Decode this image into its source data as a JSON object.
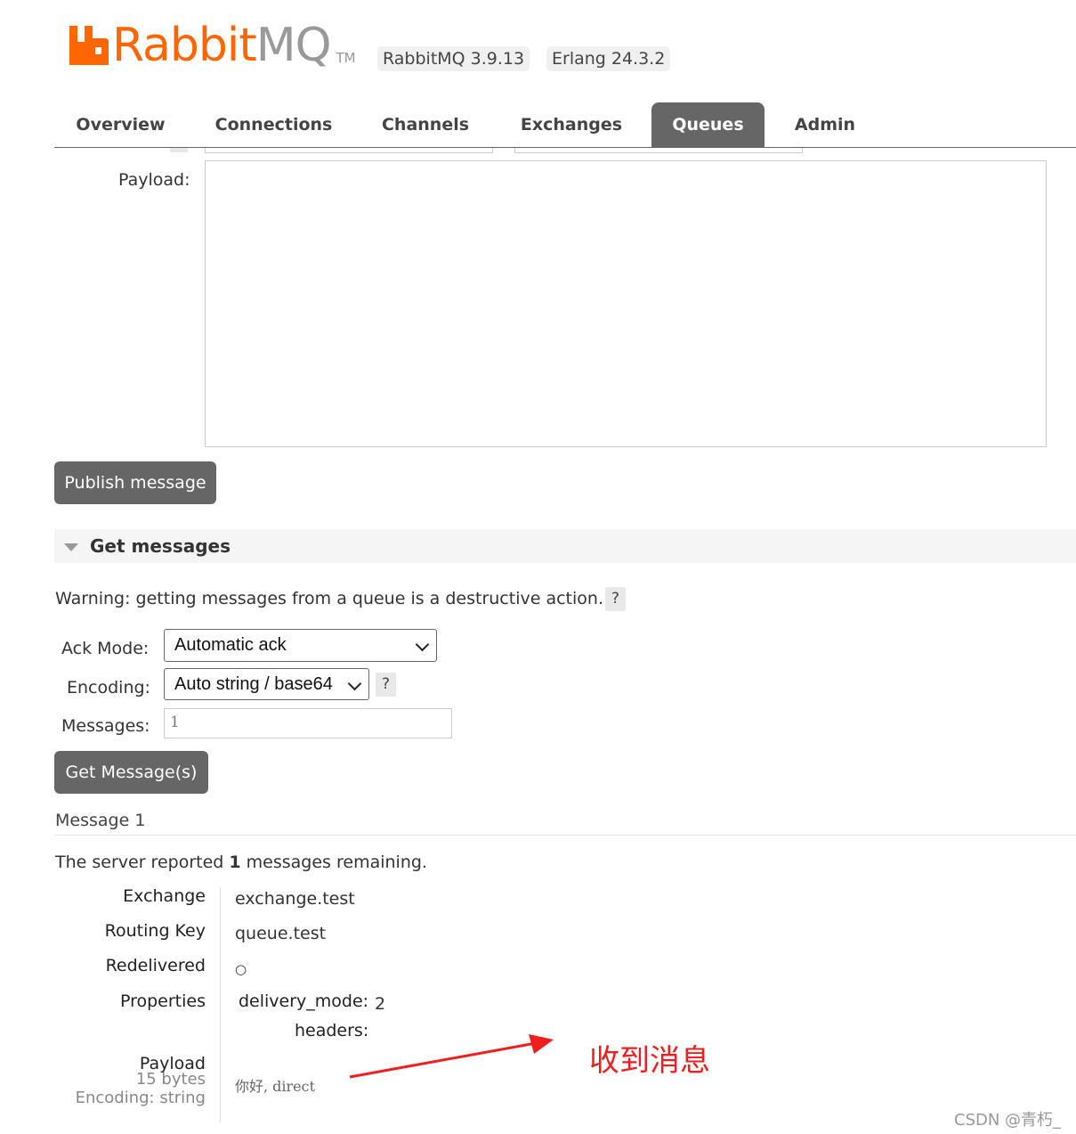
{
  "header": {
    "logo_word_rabbit": "Rabbit",
    "logo_word_mq": "MQ",
    "logo_tm": "TM",
    "version_badge": "RabbitMQ 3.9.13",
    "erlang_badge": "Erlang 24.3.2"
  },
  "nav": {
    "tabs": [
      {
        "label": "Overview"
      },
      {
        "label": "Connections"
      },
      {
        "label": "Channels"
      },
      {
        "label": "Exchanges"
      },
      {
        "label": "Queues",
        "active": true
      },
      {
        "label": "Admin"
      }
    ]
  },
  "publish": {
    "payload_label": "Payload:",
    "payload_value": "",
    "publish_button": "Publish message"
  },
  "get_messages": {
    "section_title": "Get messages",
    "warning": "Warning: getting messages from a queue is a destructive action.",
    "help_label": "?",
    "ack_mode_label": "Ack Mode:",
    "ack_mode_value": "Automatic ack",
    "encoding_label": "Encoding:",
    "encoding_value": "Auto string / base64",
    "messages_label": "Messages:",
    "messages_value": "1",
    "get_button": "Get Message(s)"
  },
  "result": {
    "message_heading": "Message 1",
    "remaining_prefix": "The server reported",
    "remaining_count": "1",
    "remaining_suffix": "messages remaining.",
    "exchange_label": "Exchange",
    "exchange_value": "exchange.test",
    "routing_key_label": "Routing Key",
    "routing_key_value": "queue.test",
    "redelivered_label": "Redelivered",
    "redelivered_value": "○",
    "properties_label": "Properties",
    "delivery_mode_label": "delivery_mode:",
    "delivery_mode_value": "2",
    "headers_label": "headers:",
    "payload_label": "Payload",
    "payload_size": "15 bytes",
    "payload_encoding": "Encoding: string",
    "payload_value": "你好, direct"
  },
  "annotation": {
    "text": "收到消息",
    "color": "#f01e1e"
  },
  "watermark": "CSDN @青朽_",
  "colors": {
    "brand_orange": "#ff6600",
    "button_gray": "#666666",
    "active_tab": "#666666"
  }
}
